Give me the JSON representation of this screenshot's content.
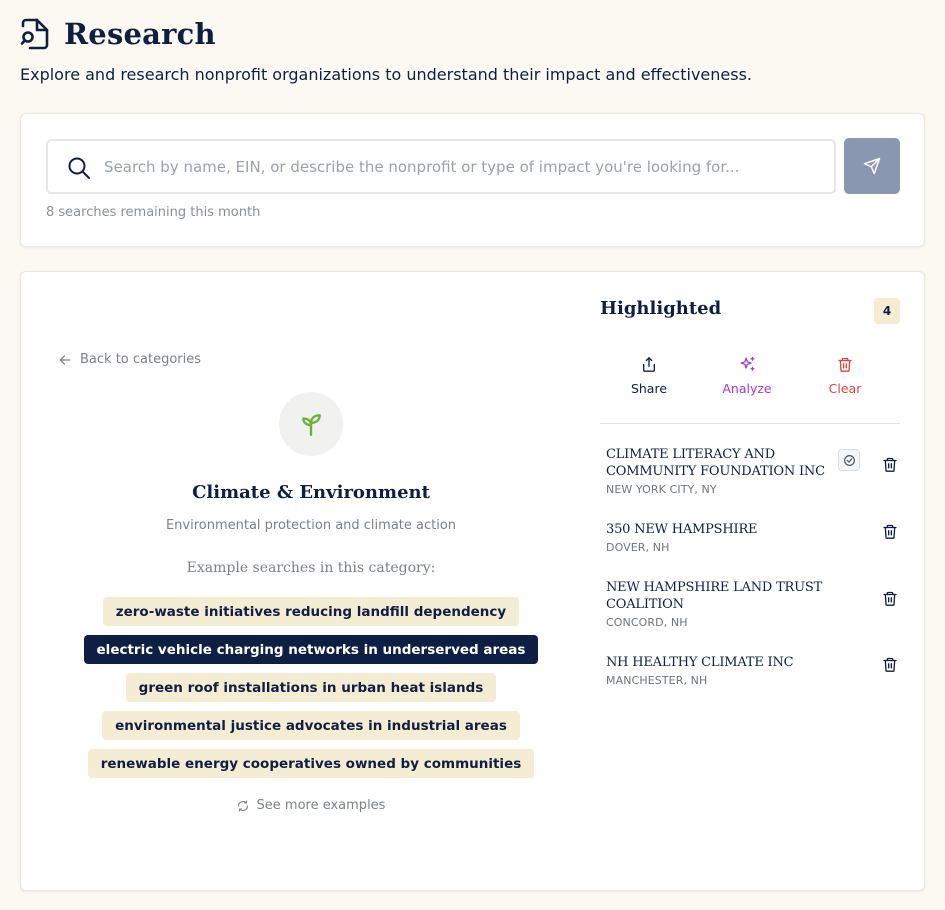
{
  "header": {
    "title": "Research",
    "subtitle": "Explore and research nonprofit organizations to understand their impact and effectiveness."
  },
  "search": {
    "placeholder": "Search by name, EIN, or describe the nonprofit or type of impact you're looking for...",
    "value": "",
    "remaining": "8 searches remaining this month"
  },
  "category": {
    "back_label": "Back to categories",
    "title": "Climate & Environment",
    "description": "Environmental protection and climate action",
    "examples_label": "Example searches in this category:",
    "examples": [
      "zero-waste initiatives reducing landfill dependency",
      "electric vehicle charging networks in underserved areas",
      "green roof installations in urban heat islands",
      "environmental justice advocates in industrial areas",
      "renewable energy cooperatives owned by communities"
    ],
    "active_example_index": 1,
    "see_more_label": "See more examples"
  },
  "highlighted": {
    "title": "Highlighted",
    "count": "4",
    "actions": {
      "share": "Share",
      "analyze": "Analyze",
      "clear": "Clear"
    },
    "items": [
      {
        "name": "CLIMATE LITERACY AND COMMUNITY FOUNDATION INC",
        "location": "NEW YORK CITY, NY"
      },
      {
        "name": "350 NEW HAMPSHIRE",
        "location": "DOVER, NH"
      },
      {
        "name": "NEW HAMPSHIRE LAND TRUST COALITION",
        "location": "CONCORD, NH"
      },
      {
        "name": "NH HEALTHY CLIMATE INC",
        "location": "MANCHESTER, NH"
      }
    ]
  },
  "colors": {
    "navy": "#0f1f44",
    "chip": "#f5ecd4",
    "analyze": "#9b3bd0",
    "clear": "#e0433b",
    "send_button": "#8a97b0",
    "leaf": "#6bb13a"
  }
}
